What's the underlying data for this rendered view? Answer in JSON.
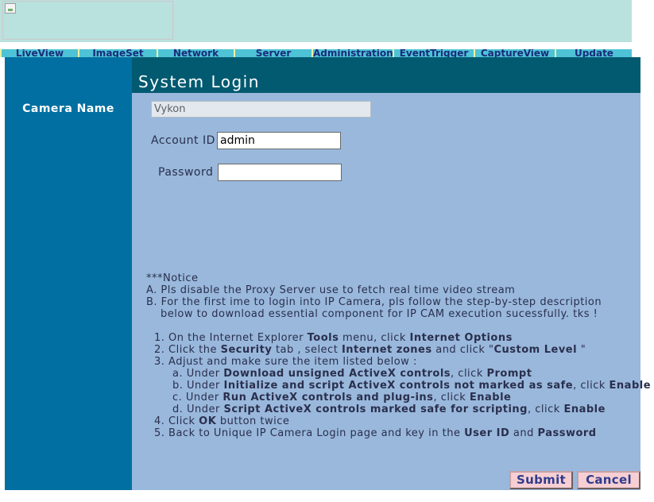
{
  "nav": {
    "items": [
      "LiveView",
      "ImageSet",
      "Network",
      "Server",
      "Administration",
      "EventTrigger",
      "CaptureView",
      "Update"
    ]
  },
  "sidebar": {
    "camera_name_label": "Camera Name"
  },
  "login": {
    "title": "System Login",
    "camera_name_value": "Vykon",
    "account_id_label": "Account ID",
    "account_id_value": "admin",
    "password_label": "Password",
    "password_value": ""
  },
  "notice": {
    "header": "***Notice",
    "a": "A. Pls disable the Proxy Server use to fetch real time video stream",
    "b1": "B. For the first ime to login into IP Camera, pls follow the step-by-step description",
    "b2": "below to download essential component for IP CAM execution sucessfully. tks !",
    "step1_pre": "1. On the Internet Explorer ",
    "step1_b1": "Tools",
    "step1_mid": " menu, click ",
    "step1_b2": "Internet Options",
    "step2_pre": "2. Click the ",
    "step2_b1": "Security",
    "step2_mid1": " tab , select ",
    "step2_b2": "Internet zones",
    "step2_mid2": " and click \"",
    "step2_b3": "Custom Level",
    "step2_end": " \"",
    "step3": "3. Adjust and make sure the item listed below :",
    "sa_pre": "a. Under ",
    "sa_b1": "Download unsigned ActiveX controls",
    "sa_mid": ", click ",
    "sa_b2": "Prompt",
    "sb_pre": "b. Under ",
    "sb_b1": "Initialize and script ActiveX controls not marked as safe",
    "sb_mid": ", click ",
    "sb_b2": "Enable",
    "sc_pre": "c. Under ",
    "sc_b1": "Run ActiveX controls and plug-ins",
    "sc_mid": ", click ",
    "sc_b2": "Enable",
    "sd_pre": "d. Under ",
    "sd_b1": "Script ActiveX controls marked safe for scripting",
    "sd_mid": ", click ",
    "sd_b2": "Enable",
    "step4_pre": "4. Click ",
    "step4_b": "OK",
    "step4_end": " button twice",
    "step5_pre": "5. Back to Unique IP Camera Login page and key in the ",
    "step5_b1": "User ID",
    "step5_mid": " and ",
    "step5_b2": "Password"
  },
  "buttons": {
    "submit": "Submit",
    "cancel": "Cancel"
  },
  "colors": {
    "header_band": "#b9e1de",
    "nav_bg": "#4ec3d6",
    "sidebar_bg": "#016fa1",
    "title_band": "#025a70",
    "main_bg": "#99b8dc",
    "button_bg": "#f7cfd3"
  },
  "icons": {
    "logo": "broken-image-icon"
  }
}
